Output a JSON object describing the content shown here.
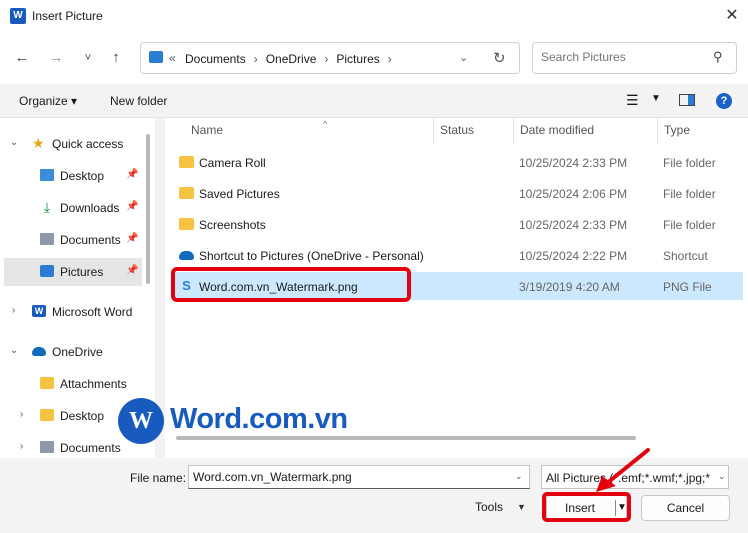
{
  "window": {
    "title": "Insert Picture",
    "close_icon": "close-icon"
  },
  "nav": {
    "back": "←",
    "forward": "→",
    "recent": "˅",
    "up": "↑",
    "breadcrumb_overflow": "«",
    "breadcrumbs": [
      "Documents",
      "OneDrive",
      "Pictures"
    ],
    "search_placeholder": "Search Pictures"
  },
  "toolbar": {
    "organize": "Organize ▾",
    "new_folder": "New folder",
    "help": "?"
  },
  "sidebar": {
    "items": [
      {
        "label": "Quick access",
        "icon": "star-icon"
      },
      {
        "label": "Desktop",
        "icon": "desktop-icon",
        "pinned": true
      },
      {
        "label": "Downloads",
        "icon": "downloads-icon",
        "pinned": true
      },
      {
        "label": "Documents",
        "icon": "documents-icon",
        "pinned": true
      },
      {
        "label": "Pictures",
        "icon": "pictures-icon",
        "pinned": true,
        "selected": true
      },
      {
        "label": "Microsoft Word",
        "icon": "word-icon"
      },
      {
        "label": "OneDrive",
        "icon": "onedrive-icon"
      },
      {
        "label": "Attachments",
        "icon": "folder-icon"
      },
      {
        "label": "Desktop",
        "icon": "folder-icon"
      },
      {
        "label": "Documents",
        "icon": "documents-icon"
      }
    ]
  },
  "columns": [
    "Name",
    "Status",
    "Date modified",
    "Type"
  ],
  "files": [
    {
      "name": "Camera Roll",
      "date": "10/25/2024 2:33 PM",
      "type": "File folder",
      "icon": "folder-icon"
    },
    {
      "name": "Saved Pictures",
      "date": "10/25/2024 2:06 PM",
      "type": "File folder",
      "icon": "folder-icon"
    },
    {
      "name": "Screenshots",
      "date": "10/25/2024 2:33 PM",
      "type": "File folder",
      "icon": "folder-icon"
    },
    {
      "name": "Shortcut to Pictures (OneDrive - Personal)",
      "date": "10/25/2024 2:22 PM",
      "type": "Shortcut",
      "icon": "onedrive-shortcut-icon"
    },
    {
      "name": "Word.com.vn_Watermark.png",
      "date": "3/19/2019 4:20 AM",
      "type": "PNG File",
      "icon": "png-file-icon",
      "selected": true
    }
  ],
  "bottom": {
    "file_name_label": "File name:",
    "file_name_value": "Word.com.vn_Watermark.png",
    "filter_value": "All Pictures (*.emf;*.wmf;*.jpg;*",
    "tools": "Tools",
    "insert": "Insert",
    "cancel": "Cancel"
  },
  "watermark": {
    "text": "Word.com.vn",
    "logo_letter": "W"
  },
  "colors": {
    "accent": "#185abd",
    "selection": "#cce8ff",
    "highlight": "#e3000f"
  }
}
